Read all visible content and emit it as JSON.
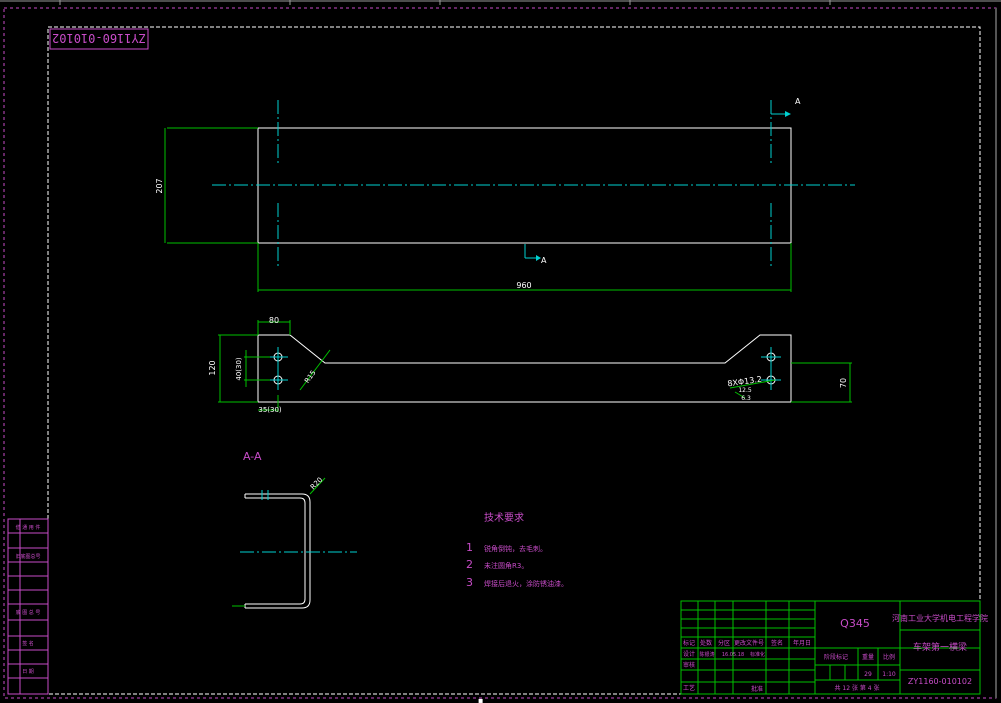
{
  "drawing": {
    "number_mirrored": "ZY1160-010102",
    "section_marker": "A",
    "section_title": "A-A",
    "dims": {
      "height_207": "207",
      "length_960": "960",
      "width_80": "80",
      "height_120": "120",
      "spacing_40": "40(30)",
      "edge_35": "35(30)",
      "chamfer": "R15",
      "holes": "8XΦ13.2",
      "roughness": "12.5",
      "roughness2": "6.3",
      "height_70": "70",
      "bend_radius": "R20"
    }
  },
  "notes": {
    "title": "技术要求",
    "items": [
      {
        "num": "1",
        "text": "锐角倒钝，去毛刺。"
      },
      {
        "num": "2",
        "text": "未注圆角R3。"
      },
      {
        "num": "3",
        "text": "焊接后退火，涂防锈油漆。"
      }
    ]
  },
  "title_block": {
    "material": "Q345",
    "school": "河南工业大学机电工程学院",
    "part_name": "车架第一横梁",
    "drawing_no": "ZY1160-010102",
    "row_labels": [
      "标记",
      "处数",
      "分区",
      "更改文件号",
      "签名",
      "年月日"
    ],
    "design_label": "设计",
    "designer": "陈银涛",
    "date": "16.05.18",
    "std_label": "标准化",
    "review_label": "审核",
    "process_label": "工艺",
    "approve_label": "批准",
    "stage_label": "阶段标记",
    "weight_label": "重量",
    "scale_label": "比例",
    "weight": "29",
    "scale": "1:10",
    "sheet_info": "共 12 张 第 4 张"
  },
  "left_strip": {
    "labels": [
      "借 通 用 件",
      "旧底图总号",
      "底 图 总 号",
      "签 名",
      "日 期"
    ]
  }
}
